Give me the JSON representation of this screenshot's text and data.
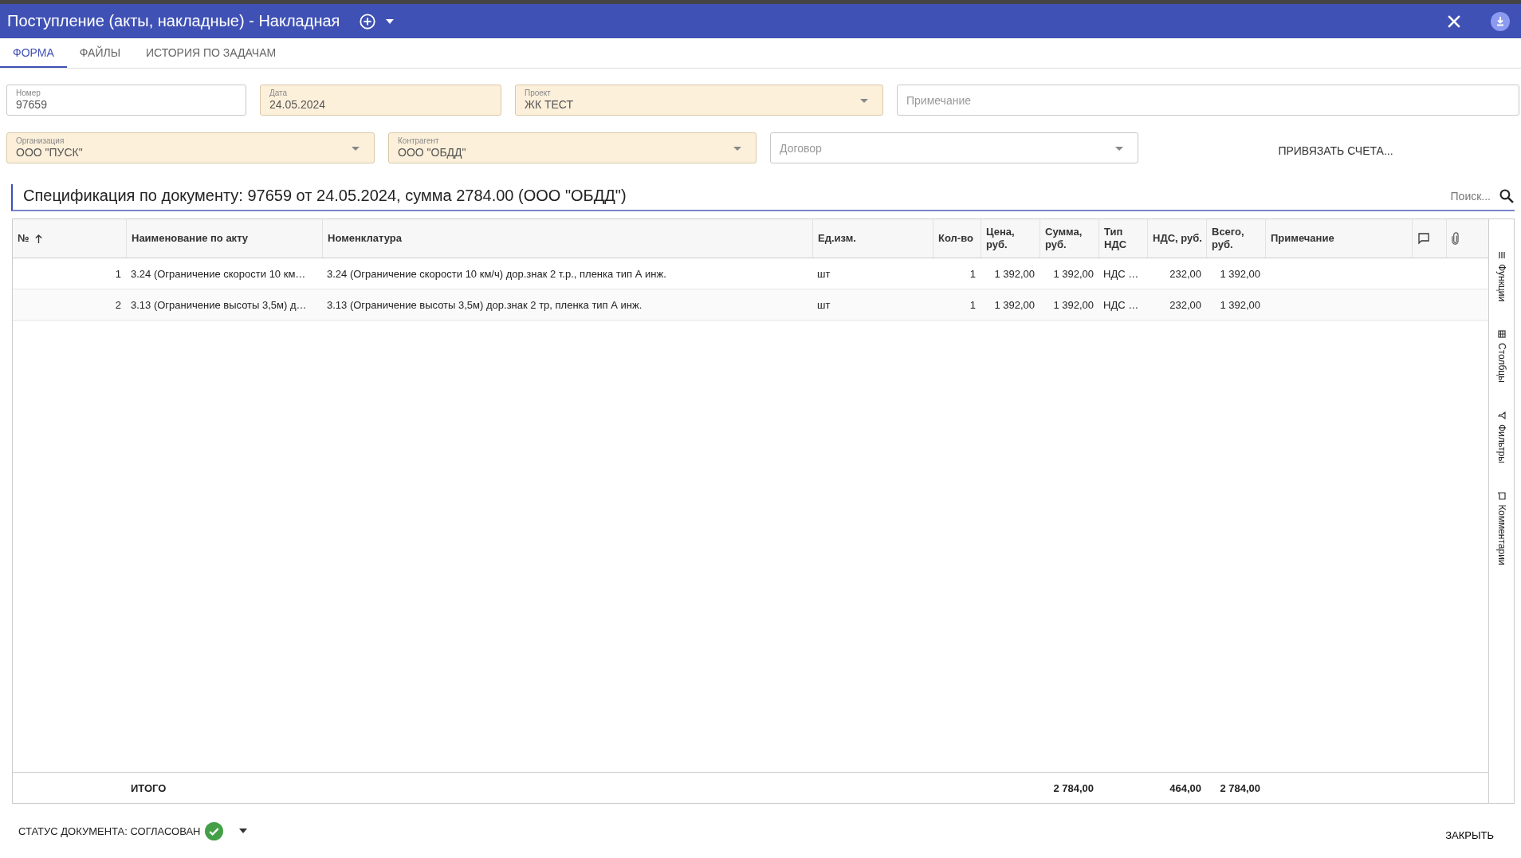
{
  "window": {
    "title": "Поступление (акты, накладные) - Накладная"
  },
  "tabs": [
    {
      "label": "ФОРМА",
      "selected": true
    },
    {
      "label": "ФАЙЛЫ",
      "selected": false
    },
    {
      "label": "ИСТОРИЯ ПО ЗАДАЧАМ",
      "selected": false
    }
  ],
  "fields_row_1": [
    {
      "kind": "text",
      "label": "Номер",
      "value": "97659",
      "required": false
    },
    {
      "kind": "text",
      "label": "Дата",
      "value": "24.05.2024",
      "required": true
    },
    {
      "kind": "select",
      "label": "Проект",
      "value": "ЖК ТЕСТ",
      "required": true
    },
    {
      "kind": "text",
      "placeholder": "Примечание",
      "required": false
    }
  ],
  "fields_row_2": [
    {
      "kind": "select",
      "label": "Организация",
      "value": "ООО \"ПУСК\"",
      "required": true
    },
    {
      "kind": "select",
      "label": "Контрагент",
      "value": "ООО \"ОБДД\"",
      "required": true
    },
    {
      "kind": "select",
      "placeholder": "Договор",
      "required": false
    }
  ],
  "link_button": "ПРИВЯЗАТЬ СЧЕТА...",
  "spec": {
    "title": "Спецификация по документу: 97659 от 24.05.2024, сумма 2784.00 (ООО \"ОБДД\")",
    "search_placeholder": "Поиск..."
  },
  "table": {
    "columns": [
      {
        "kind": "number",
        "label_lines": [
          "№"
        ],
        "sorted": true
      },
      {
        "kind": "text",
        "label_lines": [
          "Наименование по акту"
        ],
        "sorted": false
      },
      {
        "kind": "text",
        "label_lines": [
          "Номенклатура"
        ],
        "sorted": false
      },
      {
        "kind": "text",
        "label_lines": [
          "Ед.изм."
        ],
        "sorted": false
      },
      {
        "kind": "number",
        "label_lines": [
          "Кол-во"
        ],
        "sorted": false
      },
      {
        "kind": "number",
        "label_lines": [
          "Цена,",
          "руб."
        ],
        "sorted": false
      },
      {
        "kind": "number",
        "label_lines": [
          "Сумма,",
          "руб."
        ],
        "sorted": false
      },
      {
        "kind": "text",
        "label_lines": [
          "Тип",
          "НДС"
        ],
        "sorted": false
      },
      {
        "kind": "number",
        "label_lines": [
          "НДС, руб."
        ],
        "sorted": false
      },
      {
        "kind": "number",
        "label_lines": [
          "Всего,",
          "руб."
        ],
        "sorted": false
      },
      {
        "kind": "text",
        "label_lines": [
          "Примечание"
        ],
        "sorted": false
      },
      {
        "kind": "comment"
      },
      {
        "kind": "attachment"
      }
    ],
    "rows": [
      {
        "cells": [
          "1",
          "3.24 (Ограничение скорости 10 км…",
          "3.24 (Ограничение скорости 10 км/ч) дор.знак 2 т.р., пленка тип А инж.",
          "шт",
          "1",
          "1 392,00",
          "1 392,00",
          "НДС …",
          "232,00",
          "1 392,00"
        ]
      },
      {
        "cells": [
          "2",
          "3.13 (Ограничение высоты 3,5м) д…",
          "3.13 (Ограничение высоты 3,5м) дор.знак 2 тр, пленка тип А инж.",
          "шт",
          "1",
          "1 392,00",
          "1 392,00",
          "НДС …",
          "232,00",
          "1 392,00"
        ]
      }
    ],
    "totals": {
      "label": "ИТОГО",
      "sum": "2 784,00",
      "vat": "464,00",
      "total": "2 784,00"
    }
  },
  "side_panel": [
    {
      "label": "Функции"
    },
    {
      "label": "Столбцы"
    },
    {
      "label": "Фильтры"
    },
    {
      "label": "Комментарии"
    }
  ],
  "status_bar": {
    "status": "СТАТУС ДОКУМЕНТА: СОГЛАСОВАН",
    "close_button": "ЗАКРЫТЬ"
  }
}
